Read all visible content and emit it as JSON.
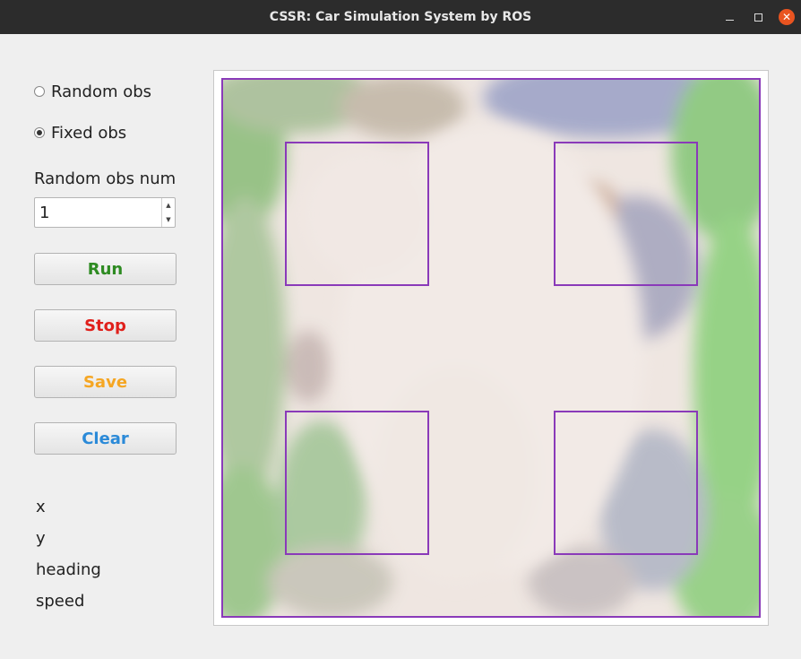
{
  "window": {
    "title": "CSSR: Car Simulation System by ROS",
    "min_icon": "minimize-icon",
    "max_icon": "maximize-icon",
    "close_icon": "close-icon",
    "close_glyph": "✕"
  },
  "controls": {
    "radio_random_label": "Random obs",
    "radio_fixed_label": "Fixed obs",
    "selected_mode": "Fixed obs",
    "random_obs_num_label": "Random obs num",
    "random_obs_num_value": "1",
    "spin_up_glyph": "▲",
    "spin_down_glyph": "▼"
  },
  "buttons": {
    "run": {
      "label": "Run",
      "color": "#2e8b22"
    },
    "stop": {
      "label": "Stop",
      "color": "#e0201b"
    },
    "save": {
      "label": "Save",
      "color": "#f5a623"
    },
    "clear": {
      "label": "Clear",
      "color": "#2b8ad8"
    }
  },
  "status": {
    "x_label": "x",
    "y_label": "y",
    "heading_label": "heading",
    "speed_label": "speed"
  },
  "colors": {
    "obstacle_outline": "#8a3ab9",
    "titlebar": "#2c2c2c",
    "close_button": "#e95420"
  }
}
